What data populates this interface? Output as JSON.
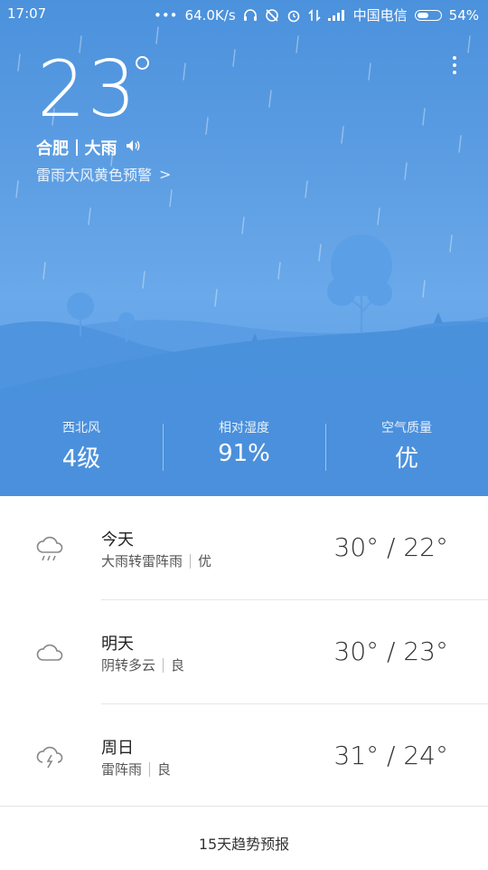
{
  "status_bar": {
    "time": "17:07",
    "speed": "64.0K/s",
    "carrier": "中国电信",
    "battery": "54%",
    "battery_level": 0.54
  },
  "current": {
    "temperature": "23",
    "city": "合肥",
    "condition": "大雨",
    "alert": "雷雨大风黄色预警",
    "alert_arrow": ">"
  },
  "stats": [
    {
      "label": "西北风",
      "value": "4级"
    },
    {
      "label": "相对湿度",
      "value": "91%"
    },
    {
      "label": "空气质量",
      "value": "优"
    }
  ],
  "forecast": [
    {
      "day": "今天",
      "condition": "大雨转雷阵雨",
      "aqi": "优",
      "range": "30° / 22°",
      "icon": "rain-cloud-icon"
    },
    {
      "day": "明天",
      "condition": "阴转多云",
      "aqi": "良",
      "range": "30° / 23°",
      "icon": "cloud-icon"
    },
    {
      "day": "周日",
      "condition": "雷阵雨",
      "aqi": "良",
      "range": "31° / 24°",
      "icon": "thunder-cloud-icon"
    }
  ],
  "footer": {
    "label": "15天趋势预报"
  },
  "colors": {
    "sky_top": "#4b91dc",
    "sky_bottom": "#5798df",
    "hill_back": "#4f93dc",
    "hill_front": "#3f88d8"
  }
}
